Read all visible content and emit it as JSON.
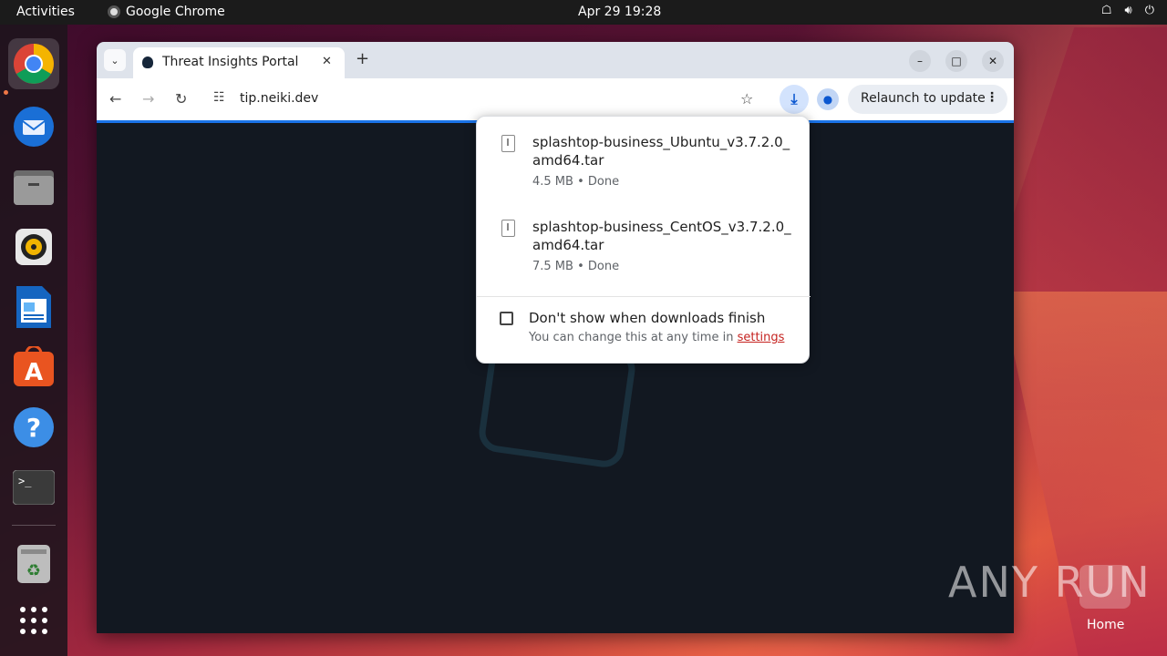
{
  "topbar": {
    "activities": "Activities",
    "app_name": "Google Chrome",
    "clock": "Apr 29  19:28"
  },
  "browser": {
    "tab_title": "Threat Insights Portal",
    "url": "tip.neiki.dev",
    "relaunch_label": "Relaunch to update"
  },
  "downloads": {
    "items": [
      {
        "name": "splashtop-business_Ubuntu_v3.7.2.0_amd64.tar",
        "meta": "4.5 MB • Done"
      },
      {
        "name": "splashtop-business_CentOS_v3.7.2.0_amd64.tar",
        "meta": "7.5 MB • Done"
      }
    ],
    "dont_show_label": "Don't show when downloads finish",
    "hint_prefix": "You can change this at any time in ",
    "settings_link": "settings"
  },
  "desktop": {
    "watermark": "ANY RUN",
    "home_label": "Home"
  }
}
